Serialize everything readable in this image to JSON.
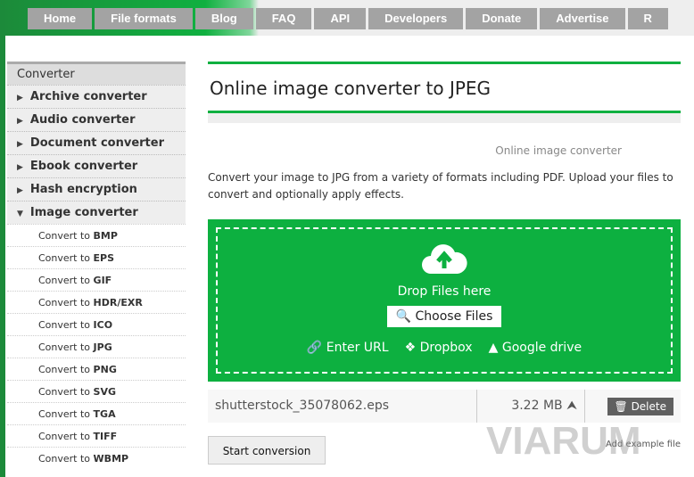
{
  "nav": [
    "Home",
    "File formats",
    "Blog",
    "FAQ",
    "API",
    "Developers",
    "Donate",
    "Advertise",
    "R"
  ],
  "sidebar": {
    "header": "Converter",
    "items": [
      "Archive converter",
      "Audio converter",
      "Document converter",
      "Ebook converter",
      "Hash encryption",
      "Image converter"
    ],
    "sub_prefix": "Convert to",
    "subs": [
      "BMP",
      "EPS",
      "GIF",
      "HDR/EXR",
      "ICO",
      "JPG",
      "PNG",
      "SVG",
      "TGA",
      "TIFF",
      "WBMP"
    ]
  },
  "main": {
    "title": "Online image converter to JPEG",
    "subtitle": "Online image converter",
    "description": "Convert your image to JPG from a variety of formats including PDF. Upload your files to convert and optionally apply effects.",
    "drop": {
      "text": "Drop Files here",
      "choose": "Choose Files",
      "url": "Enter URL",
      "dropbox": "Dropbox",
      "gdrive": "Google drive"
    },
    "file": {
      "name": "shutterstock_35078062.eps",
      "size": "3.22 MB",
      "delete": "Delete"
    },
    "start": "Start conversion",
    "add_example": "Add example file"
  },
  "watermark": "VIARUM"
}
